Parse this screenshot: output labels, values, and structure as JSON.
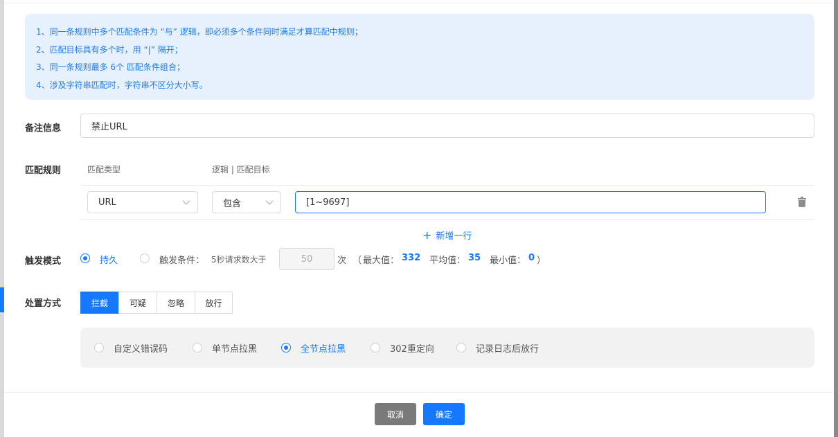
{
  "notice": {
    "lines": [
      "1、同一条规则中多个匹配条件为 “与” 逻辑，即必须多个条件同时满足才算匹配中规则；",
      "2、匹配目标具有多个时，用 “|” 隔开；",
      "3、同一条规则最多 6个 匹配条件组合；",
      "4、涉及字符串匹配时，字符串不区分大小写。"
    ]
  },
  "remark": {
    "label": "备注信息",
    "value": "禁止URL"
  },
  "match": {
    "label": "匹配规则",
    "col_type": "匹配类型",
    "col_target": "逻辑 | 匹配目标",
    "type_value": "URL",
    "logic_value": "包含",
    "target_value": "[1~9697]",
    "add_row": "新增一行"
  },
  "trigger": {
    "label": "触发模式",
    "persistent": "持久",
    "condition": "触发条件：",
    "prefix": "5秒请求数大于",
    "threshold_placeholder": "50",
    "suffix": "次",
    "stats_open": "（",
    "max_label": "最大值：",
    "max_value": "332",
    "avg_label": "平均值：",
    "avg_value": "35",
    "min_label": "最小值：",
    "min_value": "0",
    "stats_close": "）"
  },
  "handling": {
    "label": "处置方式",
    "tabs": [
      "拦截",
      "可疑",
      "忽略",
      "放行"
    ],
    "options": [
      "自定义错误码",
      "单节点拉黑",
      "全节点拉黑",
      "302重定向",
      "记录日志后放行"
    ]
  },
  "footer": {
    "cancel": "取消",
    "confirm": "确定"
  },
  "colors": {
    "accent": "#1677ff",
    "notice_bg": "#e6f1fd",
    "cancel_bg": "#7a7a7a"
  }
}
